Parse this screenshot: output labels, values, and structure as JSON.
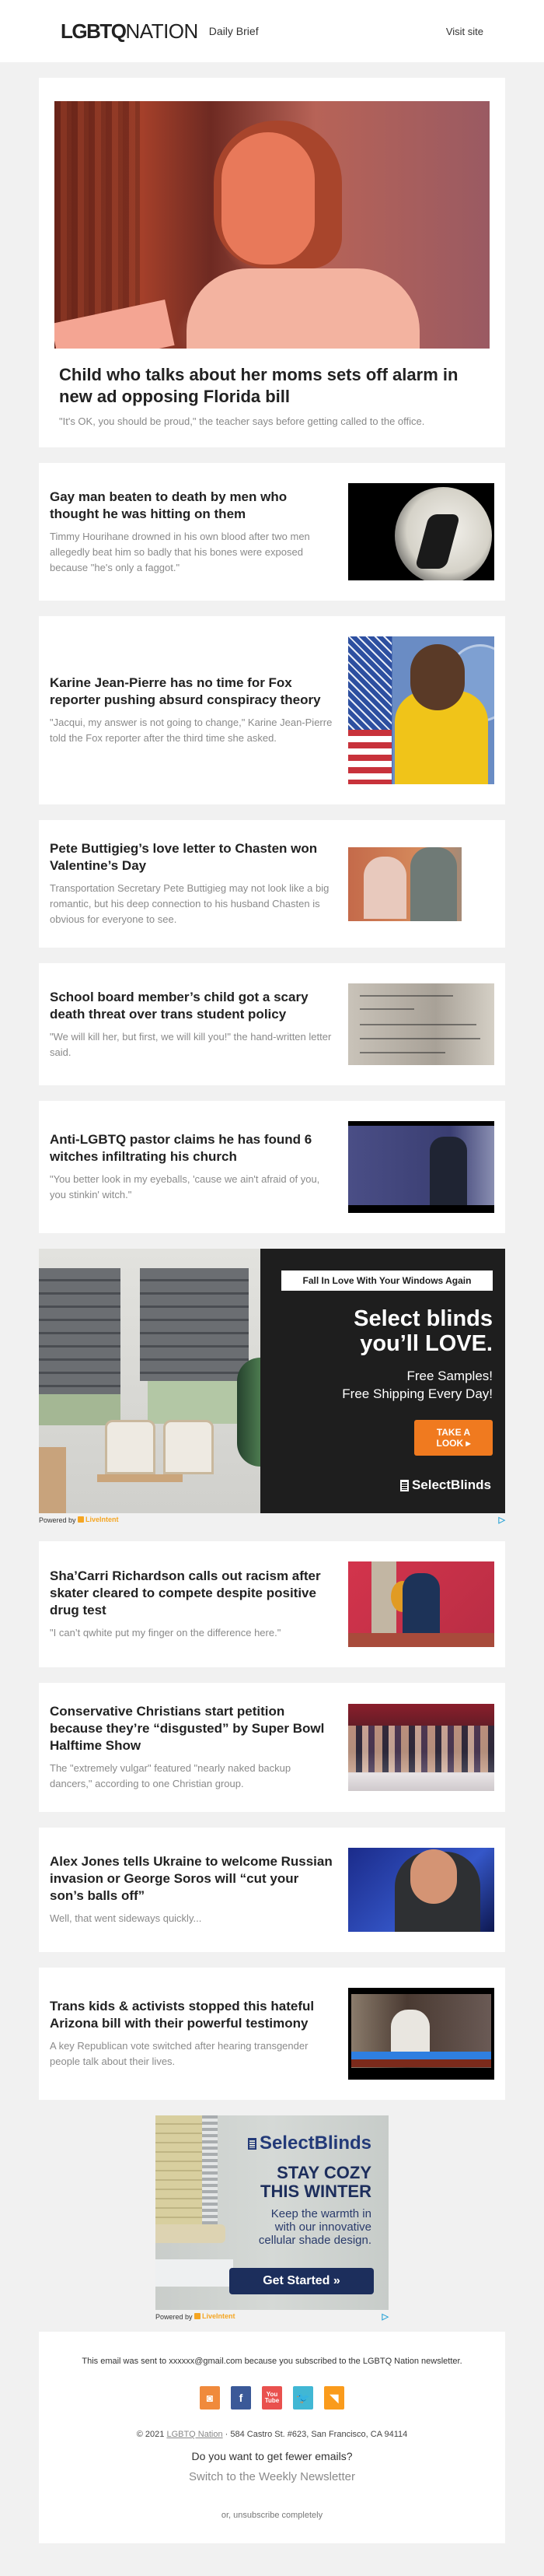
{
  "header": {
    "logo_bold": "LGBTQ",
    "logo_light": "NATION",
    "tagline": "Daily Brief",
    "visit_link": "Visit site"
  },
  "hero": {
    "image_alt": "Girl looking up in classroom",
    "title": "Child who talks about her moms sets off alarm in new ad opposing Florida bill",
    "summary": "\"It's OK, you should be proud,\" the teacher says before getting called to the office."
  },
  "stories": [
    {
      "title": "Gay man beaten to death by men who thought he was hitting on them",
      "summary": "Timmy Hourihane drowned in his own blood after two men allegedly beat him so badly that his bones were exposed because \"he's only a faggot.\""
    },
    {
      "title": "Karine Jean-Pierre has no time for Fox reporter pushing absurd conspiracy theory",
      "summary": "\"Jacqui, my answer is not going to change,\" Karine Jean-Pierre told the Fox reporter after the third time she asked."
    },
    {
      "title": "Pete Buttigieg’s love letter to Chasten won Valentine’s Day",
      "summary": "Transportation Secretary Pete Buttigieg may not look like a big romantic, but his deep connection to his husband Chasten is obvious for everyone to see."
    },
    {
      "title": "School board member’s child got a scary death threat over trans student policy",
      "summary": "\"We will kill her, but first, we will kill you!\" the hand-written letter said."
    },
    {
      "title": "Anti-LGBTQ pastor claims he has found 6 witches infiltrating his church",
      "summary": "\"You better look in my eyeballs, 'cause we ain't afraid of you, you stinkin' witch.\""
    },
    {
      "title": "Sha’Carri Richardson calls out racism after skater cleared to compete despite positive drug test",
      "summary": "\"I can’t qwhite put my finger on the difference here.\""
    },
    {
      "title": "Conservative Christians start petition because they’re “disgusted” by Super Bowl Halftime Show",
      "summary": "The \"extremely vulgar\" featured \"nearly naked backup dancers,\" according to one Christian group."
    },
    {
      "title": "Alex Jones tells Ukraine to welcome Russian invasion or George Soros will “cut your son’s balls off”",
      "summary": "Well, that went sideways quickly..."
    },
    {
      "title": "Trans kids & activists stopped this hateful Arizona bill with their powerful testimony",
      "summary": "A key Republican vote switched after hearing transgender people talk about their lives."
    }
  ],
  "ad1": {
    "tag": "Fall In Love With Your Windows Again",
    "headline_1": "Select blinds",
    "headline_2": "you’ll LOVE.",
    "body_1": "Free Samples!",
    "body_2": "Free Shipping Every Day!",
    "cta": "TAKE A LOOK ▸",
    "brand": "SelectBlinds",
    "powered_by": "Powered by",
    "powered_brand": "LiveIntent",
    "adchoice": "▷"
  },
  "ad2": {
    "brand": "SelectBlinds",
    "headline_1": "STAY COZY",
    "headline_2": "THIS WINTER",
    "body_1": "Keep the warmth in",
    "body_2": "with our innovative",
    "body_3": "cellular shade design.",
    "cta": "Get Started »",
    "powered_by": "Powered by",
    "powered_brand": "LiveIntent",
    "adchoice": "▷"
  },
  "footer": {
    "sent_note": "This email was sent to xxxxxx@gmail.com because you subscribed to the LGBTQ Nation newsletter.",
    "socials": [
      {
        "name": "instagram",
        "glyph": "◙"
      },
      {
        "name": "facebook",
        "glyph": "f"
      },
      {
        "name": "youtube",
        "glyph": "You Tube"
      },
      {
        "name": "twitter",
        "glyph": "🐦"
      },
      {
        "name": "rss",
        "glyph": "◥"
      }
    ],
    "copyright_prefix": "© 2021",
    "copyright_link": "LGBTQ Nation",
    "address": "· 584 Castro St. #623, San Francisco, CA 94114",
    "fewer_emails": "Do you want to get fewer emails?",
    "switch_link": "Switch to the Weekly Newsletter",
    "unsubscribe": "or, unsubscribe completely"
  },
  "colors": {
    "page_bg": "#f1f1f1",
    "card_bg": "#ffffff",
    "title_text": "#222222",
    "summary_text": "#8a8a8a",
    "ad1_cta": "#f07a1f",
    "ad2_cta": "#1c2e5c",
    "liveintent": "#f5a623"
  }
}
